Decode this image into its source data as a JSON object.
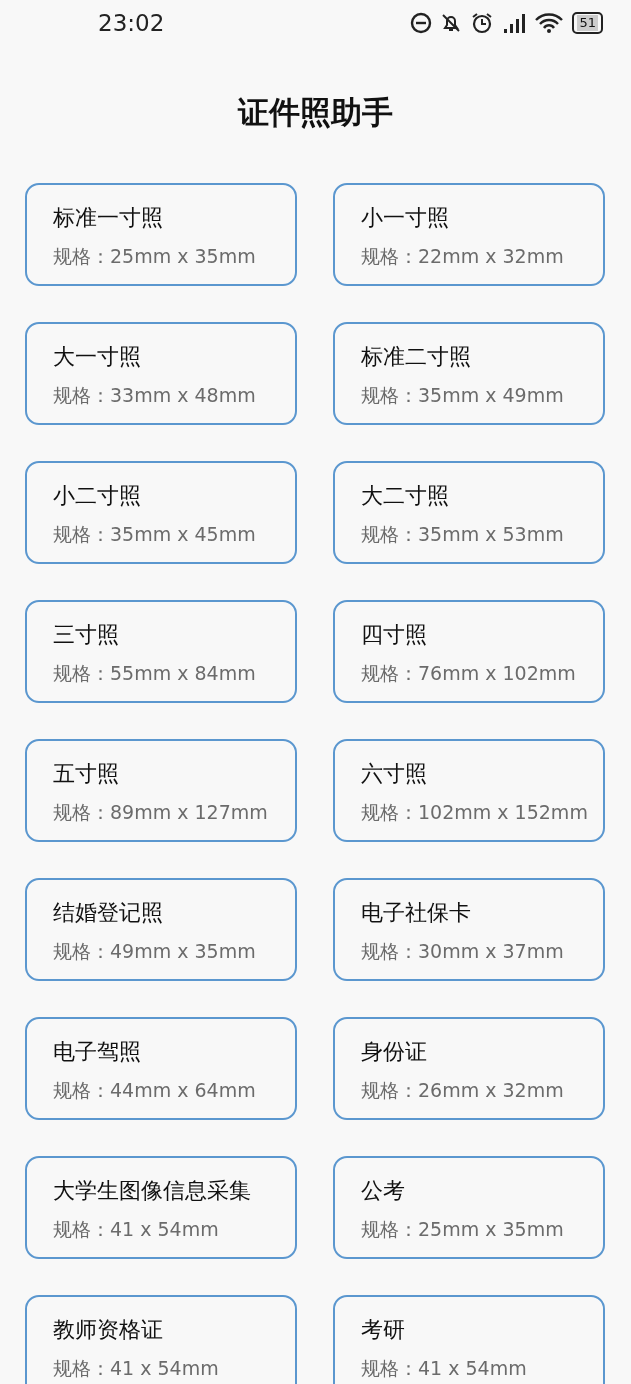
{
  "status_bar": {
    "time": "23:02",
    "battery": "51"
  },
  "title": "证件照助手",
  "cards": [
    {
      "name": "标准一寸照",
      "spec": "规格：25mm x 35mm"
    },
    {
      "name": "小一寸照",
      "spec": "规格：22mm x 32mm"
    },
    {
      "name": "大一寸照",
      "spec": "规格：33mm x 48mm"
    },
    {
      "name": "标准二寸照",
      "spec": "规格：35mm x 49mm"
    },
    {
      "name": "小二寸照",
      "spec": "规格：35mm x 45mm"
    },
    {
      "name": "大二寸照",
      "spec": "规格：35mm x 53mm"
    },
    {
      "name": "三寸照",
      "spec": "规格：55mm x 84mm"
    },
    {
      "name": "四寸照",
      "spec": "规格：76mm x 102mm"
    },
    {
      "name": "五寸照",
      "spec": "规格：89mm x 127mm"
    },
    {
      "name": "六寸照",
      "spec": "规格：102mm x 152mm"
    },
    {
      "name": "结婚登记照",
      "spec": "规格：49mm x 35mm"
    },
    {
      "name": "电子社保卡",
      "spec": "规格：30mm x 37mm"
    },
    {
      "name": "电子驾照",
      "spec": "规格：44mm x 64mm"
    },
    {
      "name": "身份证",
      "spec": "规格：26mm x 32mm"
    },
    {
      "name": "大学生图像信息采集",
      "spec": "规格：41 x 54mm"
    },
    {
      "name": "公考",
      "spec": "规格：25mm x 35mm"
    },
    {
      "name": "教师资格证",
      "spec": "规格：41 x 54mm"
    },
    {
      "name": "考研",
      "spec": "规格：41 x 54mm"
    }
  ]
}
